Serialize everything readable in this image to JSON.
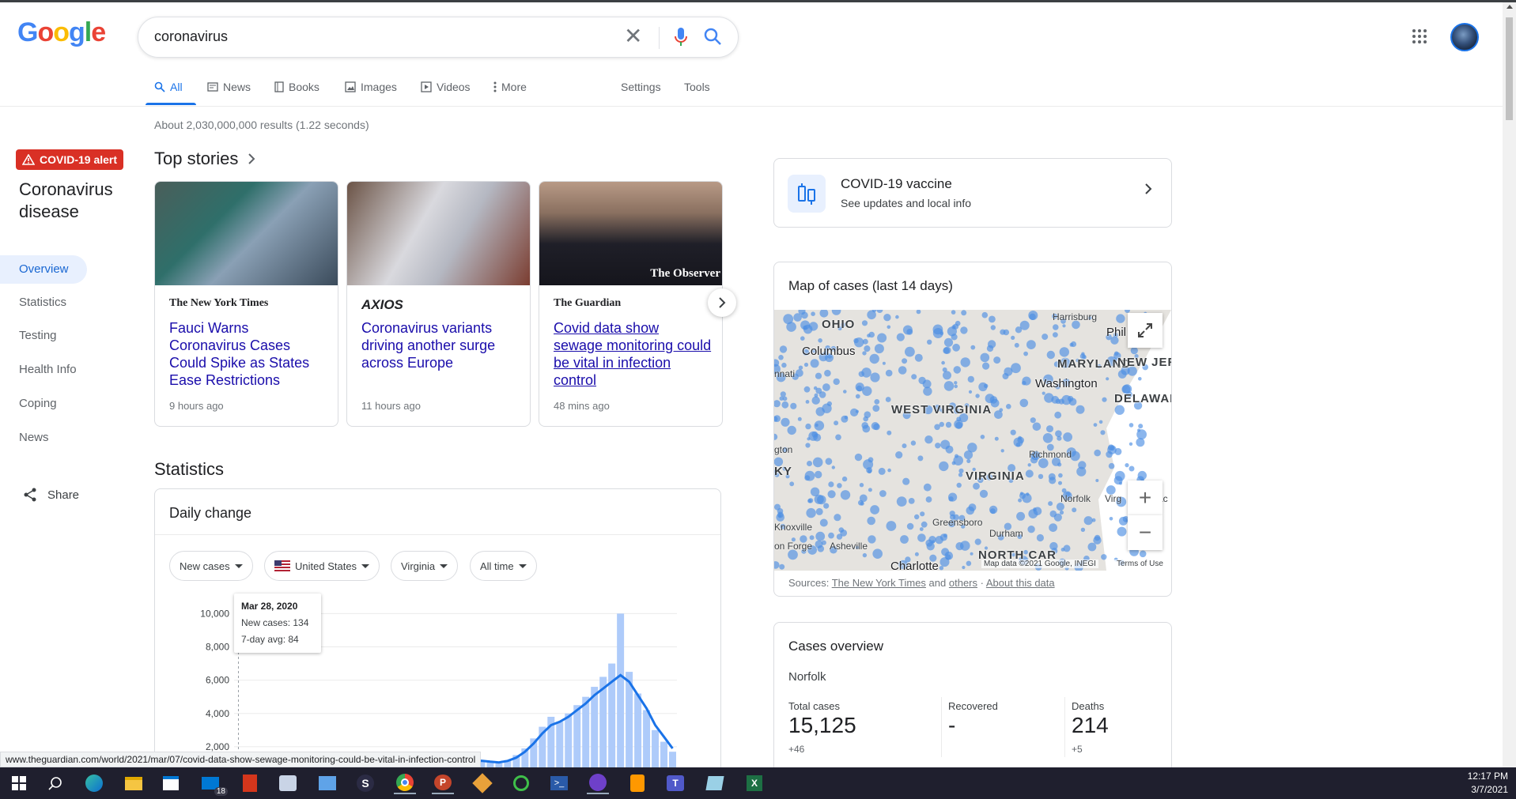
{
  "search": {
    "query": "coronavirus"
  },
  "tabs": [
    {
      "label": "All"
    },
    {
      "label": "News"
    },
    {
      "label": "Books"
    },
    {
      "label": "Images"
    },
    {
      "label": "Videos"
    },
    {
      "label": "More"
    },
    {
      "label": "Settings"
    },
    {
      "label": "Tools"
    }
  ],
  "result_stats": "About 2,030,000,000 results (1.22 seconds)",
  "sidebar": {
    "alert": "COVID-19 alert",
    "title": "Coronavirus disease",
    "items": [
      "Overview",
      "Statistics",
      "Testing",
      "Health Info",
      "Coping",
      "News"
    ],
    "share": "Share"
  },
  "top_stories": {
    "title": "Top stories",
    "cards": [
      {
        "source": "The New York Times",
        "headline": "Fauci Warns Coronavirus Cases Could Spike as States Ease Restrictions",
        "time": "9 hours ago"
      },
      {
        "source": "AXIOS",
        "headline": "Coronavirus variants driving another surge across Europe",
        "time": "11 hours ago"
      },
      {
        "source": "The Guardian",
        "headline": "Covid data show sewage monitoring could be vital in infection control",
        "time": "48 mins ago",
        "image_caption": "The Observer"
      }
    ]
  },
  "statistics": {
    "title": "Statistics",
    "card_title": "Daily change",
    "filters": [
      "New cases",
      "United States",
      "Virginia",
      "All time"
    ],
    "tooltip": {
      "date": "Mar 28, 2020",
      "new_cases": "New cases: 134",
      "avg": "7-day avg: 84"
    },
    "y_ticks": [
      "10,000",
      "8,000",
      "6,000",
      "4,000",
      "2,000"
    ]
  },
  "chart_data": {
    "type": "bar",
    "ylim": [
      0,
      10000
    ],
    "y_ticks": [
      2000,
      4000,
      6000,
      8000,
      10000
    ],
    "series": [
      {
        "name": "New cases",
        "values": [
          134,
          200,
          400,
          700,
          900,
          1000,
          800,
          700,
          600,
          500,
          400,
          500,
          600,
          800,
          900,
          1000,
          900,
          800,
          700,
          800,
          1000,
          1100,
          1000,
          900,
          800,
          900,
          1100,
          1300,
          1200,
          1100,
          1000,
          1200,
          1500,
          1900,
          2500,
          3200,
          3800,
          3500,
          4000,
          4500,
          5000,
          5600,
          6200,
          7000,
          10000,
          6500,
          5200,
          4200,
          3000,
          2300,
          1700
        ]
      },
      {
        "name": "7-day avg",
        "values": [
          84,
          150,
          300,
          550,
          760,
          880,
          840,
          760,
          660,
          560,
          480,
          500,
          560,
          700,
          820,
          900,
          880,
          820,
          760,
          780,
          900,
          1000,
          980,
          920,
          860,
          880,
          1000,
          1150,
          1160,
          1100,
          1060,
          1150,
          1350,
          1700,
          2200,
          2800,
          3300,
          3500,
          3800,
          4200,
          4600,
          5100,
          5500,
          5900,
          6300,
          5900,
          5100,
          4300,
          3300,
          2600,
          1900
        ]
      }
    ]
  },
  "vaccine": {
    "title": "COVID-19 vaccine",
    "subtitle": "See updates and local info"
  },
  "map": {
    "title": "Map of cases (last 14 days)",
    "state_labels": [
      "OHIO",
      "WEST VIRGINIA",
      "VIRGINIA",
      "MARYLAND",
      "DELAWARE",
      "NEW JER",
      "KY",
      "NORTH CAR"
    ],
    "city_labels": [
      "Columbus",
      "Washington",
      "Phil",
      "Harrisburg",
      "Richmond",
      "Norfolk",
      "Virg",
      "Greensboro",
      "Durham",
      "Knoxville",
      "Asheville",
      "Charlotte",
      "nnati",
      "gton",
      "on Forge",
      "ac"
    ],
    "credit": "Map data ©2021 Google, INEGI",
    "terms": "Terms of Use",
    "sources_prefix": "Sources:",
    "source_nyt": "The New York Times",
    "and": "and",
    "others": "others",
    "about": "About this data"
  },
  "cases": {
    "title": "Cases overview",
    "location": "Norfolk",
    "stats": [
      {
        "label": "Total cases",
        "value": "15,125",
        "delta": "+46"
      },
      {
        "label": "Recovered",
        "value": "-",
        "delta": ""
      },
      {
        "label": "Deaths",
        "value": "214",
        "delta": "+5"
      }
    ]
  },
  "status_url": "www.theguardian.com/world/2021/mar/07/covid-data-show-sewage-monitoring-could-be-vital-in-infection-control",
  "taskbar": {
    "time": "12:17 PM",
    "date": "3/7/2021",
    "mail_badge": "18"
  }
}
